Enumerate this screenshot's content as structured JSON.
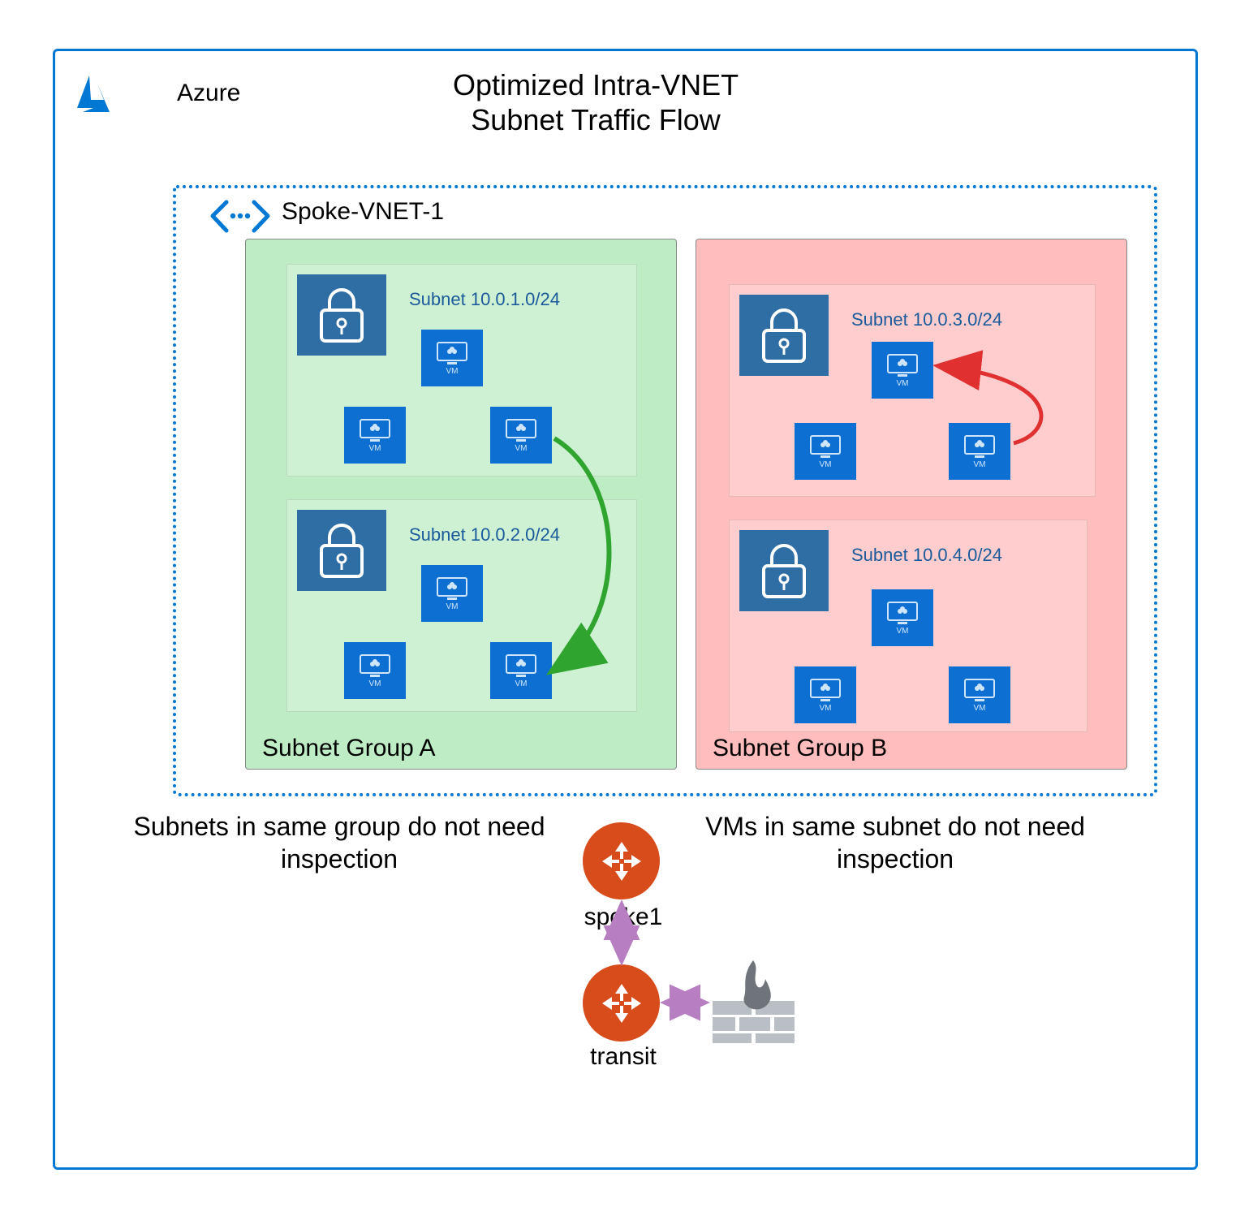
{
  "cloud": {
    "provider_label": "Azure"
  },
  "diagram": {
    "title_line1": "Optimized Intra-VNET",
    "title_line2": "Subnet Traffic Flow"
  },
  "vnet": {
    "name": "Spoke-VNET-1",
    "groups": {
      "a": {
        "label": "Subnet Group A",
        "subnets": [
          {
            "cidr": "Subnet 10.0.1.0/24"
          },
          {
            "cidr": "Subnet 10.0.2.0/24"
          }
        ]
      },
      "b": {
        "label": "Subnet Group B",
        "subnets": [
          {
            "cidr": "Subnet 10.0.3.0/24"
          },
          {
            "cidr": "Subnet 10.0.4.0/24"
          }
        ]
      }
    }
  },
  "notes": {
    "left": "Subnets in same group do not need inspection",
    "right": "VMs in same subnet do not need inspection"
  },
  "gateways": {
    "spoke1": {
      "label": "spoke1"
    },
    "transit": {
      "label": "transit"
    }
  },
  "vm_caption": "VM",
  "colors": {
    "azure_blue": "#0078d4",
    "group_a_fill": "rgba(70,200,90,0.35)",
    "group_b_fill": "rgba(255,90,90,0.40)",
    "gateway_fill": "#d84b1a",
    "arrow_green": "#2fa52f",
    "arrow_red": "#e03030",
    "arrow_purple": "#b77fc2"
  },
  "chart_data": {
    "type": "diagram",
    "title": "Optimized Intra-VNET Subnet Traffic Flow",
    "cloud": "Azure",
    "vnet": "Spoke-VNET-1",
    "subnet_groups": [
      {
        "name": "Subnet Group A",
        "color": "green",
        "subnets": [
          "10.0.1.0/24",
          "10.0.2.0/24"
        ],
        "vms_per_subnet": 3
      },
      {
        "name": "Subnet Group B",
        "color": "red",
        "subnets": [
          "10.0.3.0/24",
          "10.0.4.0/24"
        ],
        "vms_per_subnet": 3
      }
    ],
    "flows": [
      {
        "from": "GroupA / 10.0.1.0/24 VM",
        "to": "GroupA / 10.0.2.0/24 VM",
        "color": "green",
        "meaning": "cross-subnet same-group, no inspection"
      },
      {
        "from": "GroupB / 10.0.3.0/24 VM",
        "to": "GroupB / 10.0.3.0/24 VM",
        "color": "red",
        "meaning": "same-subnet, no inspection"
      },
      {
        "from": "spoke1 gateway",
        "to": "transit gateway",
        "bidirectional": true,
        "color": "purple"
      },
      {
        "from": "transit gateway",
        "to": "firewall",
        "bidirectional": true,
        "color": "purple"
      }
    ],
    "gateways": [
      "spoke1",
      "transit"
    ],
    "firewall_present": true,
    "annotations": [
      "Subnets in same group do not need inspection",
      "VMs in same subnet do not need inspection"
    ]
  }
}
